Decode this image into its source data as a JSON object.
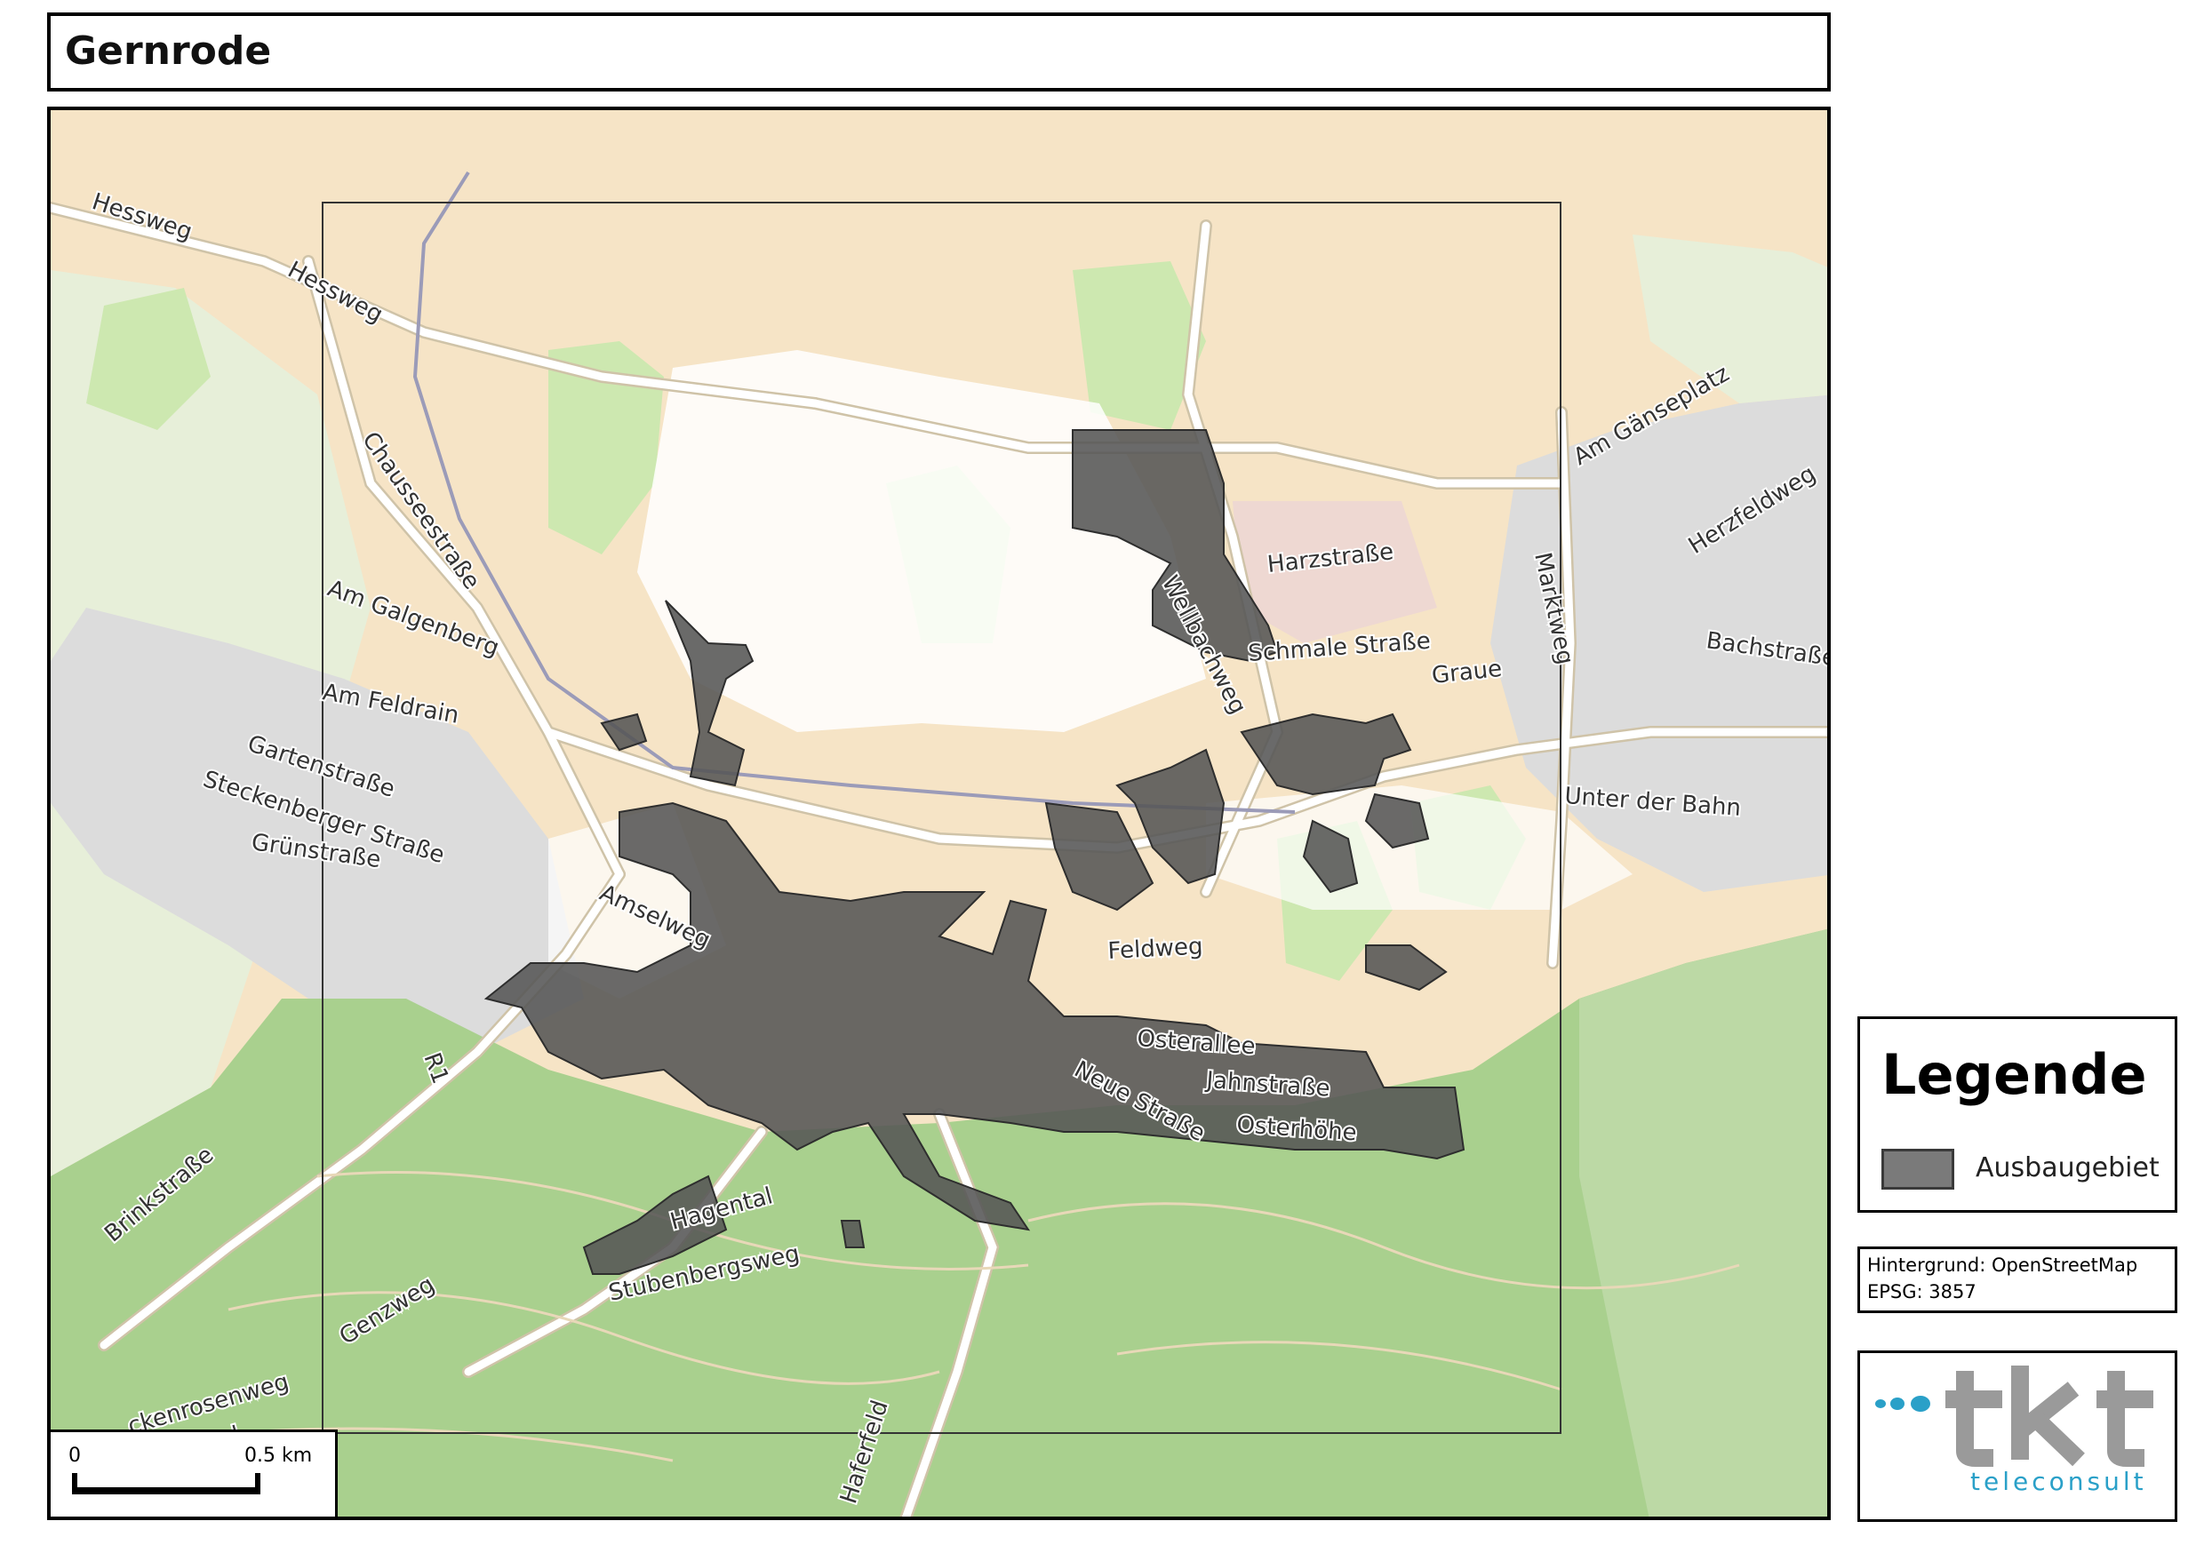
{
  "title": "Gernrode",
  "map": {
    "street_labels": [
      "Hessweg",
      "Hessweg",
      "Chausseestraße",
      "Am Galgenberg",
      "Am Feldrain",
      "Gartenstraße",
      "Steckenberger Straße",
      "Grünstraße",
      "Amselweg",
      "R1",
      "Brinkstraße",
      "Hagental",
      "Stubenbergsweg",
      "Genzweg",
      "ckenrosenweg",
      "agental",
      "Haferfeld",
      "Wellbachweg",
      "Harzstraße",
      "Schmale Straße",
      "Graue",
      "Marktweg",
      "Am Gänseplatz",
      "Herzfeldweg",
      "Bachstraße",
      "Unter der Bahn",
      "Feldweg",
      "Osterallee",
      "Neue Straße",
      "Jahnstraße",
      "Osterhöhe"
    ],
    "colors": {
      "farmland": "#f6e4c6",
      "urban": "#dcdcdc",
      "forest": "#a9d08e",
      "grass": "#cde8b0",
      "road": "#ffffff",
      "road_outline": "#cfc3a8",
      "rail": "#9b9bb8",
      "ausbaugebiet": "#555555"
    }
  },
  "scalebar": {
    "zero": "0",
    "distance": "0.5 km"
  },
  "legend": {
    "title": "Legende",
    "item": "Ausbaugebiet",
    "swatch_color": "#7a7a7a"
  },
  "info": {
    "line1": "Hintergrund: OpenStreetMap",
    "line2": "EPSG: 3857"
  },
  "logo": {
    "brand": "tkt",
    "subtitle": "teleconsult"
  }
}
